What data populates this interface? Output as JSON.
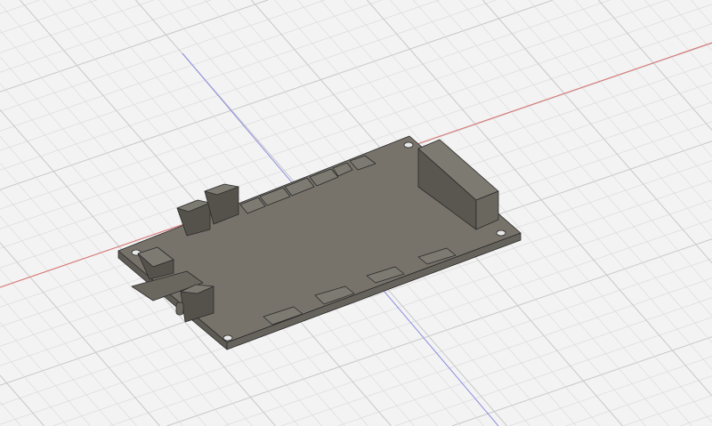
{
  "viewport": {
    "background": "#f3f3f3",
    "grid_minor_color": "#dcdcdc",
    "grid_major_color": "#c8c8c8",
    "x_axis_color": "#e07070",
    "y_axis_color": "#8c8ce0"
  },
  "model": {
    "icon": "pcb-board-icon",
    "top_color": "#77736b",
    "side_color": "#5e5b55",
    "edge_color": "#2a2a2a",
    "component_top_color": "#7d7a72",
    "component_side_color": "#55524c"
  }
}
